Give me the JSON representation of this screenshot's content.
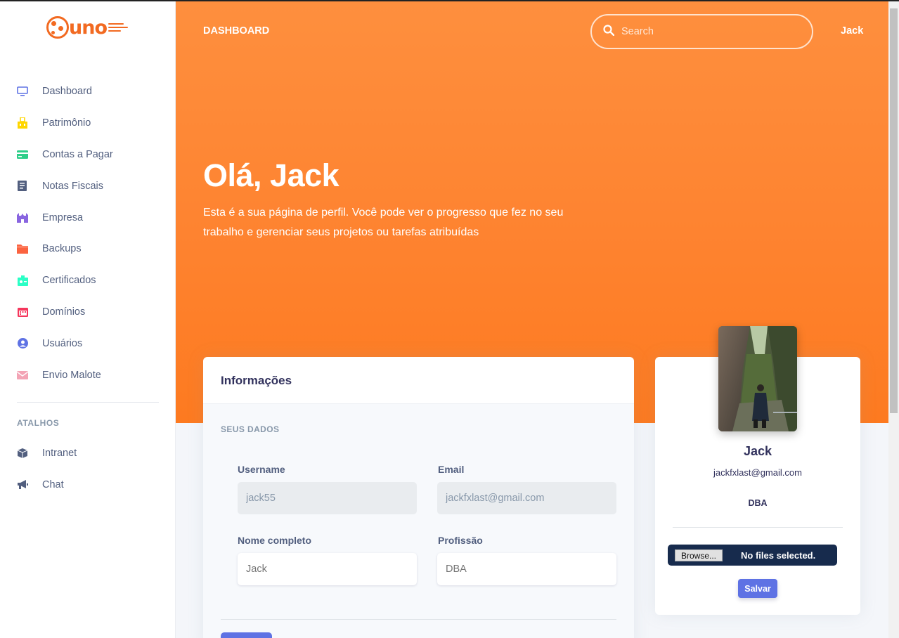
{
  "brand": {
    "logo_text": "uno",
    "color": "#f26a21"
  },
  "sidebar": {
    "items": [
      {
        "label": "Dashboard",
        "icon": "monitor-icon",
        "color": "#5e72e4"
      },
      {
        "label": "Patrimônio",
        "icon": "building-icon",
        "color": "#ffd600"
      },
      {
        "label": "Contas a Pagar",
        "icon": "credit-card-icon",
        "color": "#2dce89"
      },
      {
        "label": "Notas Fiscais",
        "icon": "document-icon",
        "color": "#525f7f"
      },
      {
        "label": "Empresa",
        "icon": "castle-icon",
        "color": "#8965e0"
      },
      {
        "label": "Backups",
        "icon": "folder-icon",
        "color": "#fb6340"
      },
      {
        "label": "Certificados",
        "icon": "badge-icon",
        "color": "#2bffc6"
      },
      {
        "label": "Domínios",
        "icon": "calendar-icon",
        "color": "#f5365c"
      },
      {
        "label": "Usuários",
        "icon": "user-circle-icon",
        "color": "#5e72e4"
      },
      {
        "label": "Envio Malote",
        "icon": "envelope-icon",
        "color": "#f3a4b5"
      }
    ],
    "section_title": "ATALHOS",
    "shortcuts": [
      {
        "label": "Intranet",
        "icon": "box-icon",
        "color": "#525f7f"
      },
      {
        "label": "Chat",
        "icon": "megaphone-icon",
        "color": "#525f7f"
      }
    ]
  },
  "header": {
    "title": "DASHBOARD",
    "search_placeholder": "Search",
    "user": "Jack"
  },
  "hero": {
    "greeting": "Olá, Jack",
    "description": "Esta é a sua página de perfil. Você pode ver o progresso que fez no seu trabalho e gerenciar seus projetos ou tarefas atribuídas"
  },
  "info_card": {
    "title": "Informações",
    "subtitle": "SEUS DADOS",
    "fields": {
      "username": {
        "label": "Username",
        "value": "jack55"
      },
      "email": {
        "label": "Email",
        "value": "jackfxlast@gmail.com"
      },
      "fullname": {
        "label": "Nome completo",
        "placeholder": "Jack"
      },
      "profession": {
        "label": "Profissão",
        "placeholder": "DBA"
      }
    }
  },
  "profile": {
    "name": "Jack",
    "email": "jackfxlast@gmail.com",
    "role": "DBA",
    "browse_label": "Browse...",
    "file_status": "No files selected.",
    "save_label": "Salvar"
  },
  "colors": {
    "primary": "#5e72e4",
    "hero": "#fe8330",
    "dark": "#172b4d"
  }
}
